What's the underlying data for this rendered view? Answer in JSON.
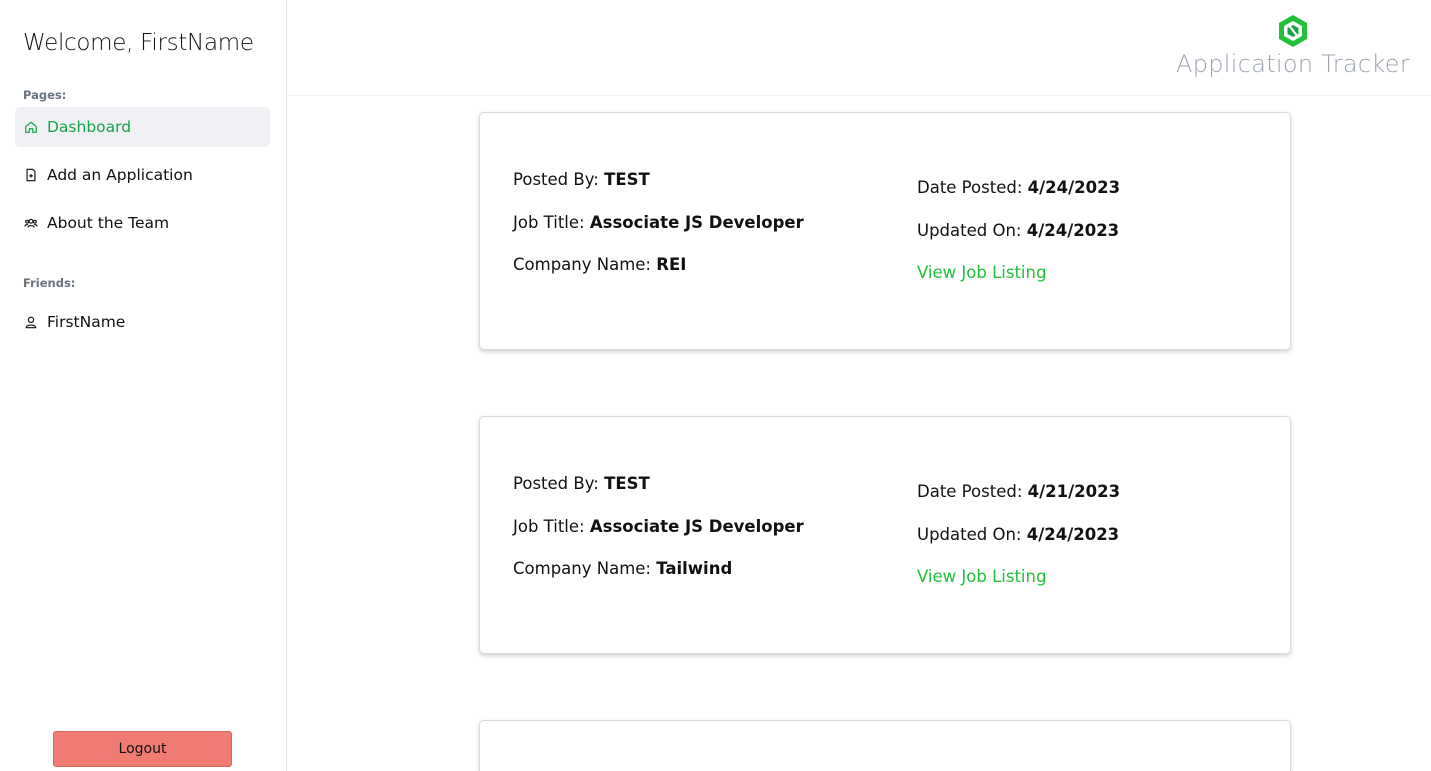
{
  "sidebar": {
    "welcome": "Welcome, FirstName",
    "pages_label": "Pages:",
    "nav": [
      {
        "label": "Dashboard",
        "icon": "home-icon",
        "active": true
      },
      {
        "label": "Add an Application",
        "icon": "file-plus-icon",
        "active": false
      },
      {
        "label": "About the Team",
        "icon": "users-icon",
        "active": false
      }
    ],
    "friends_label": "Friends:",
    "friends": [
      {
        "label": "FirstName",
        "icon": "user-icon"
      }
    ],
    "logout_label": "Logout"
  },
  "header": {
    "logo_text": "Application Tracker",
    "logo_icon": "hexagon-logo-icon"
  },
  "labels": {
    "posted_by": "Posted By:",
    "job_title": "Job Title:",
    "company_name": "Company Name:",
    "date_posted": "Date Posted:",
    "updated_on": "Updated On:",
    "view_listing": "View Job Listing"
  },
  "jobs": [
    {
      "posted_by": "TEST",
      "job_title": "Associate JS Developer",
      "company": "REI",
      "date_posted": "4/24/2023",
      "updated_on": "4/24/2023"
    },
    {
      "posted_by": "TEST",
      "job_title": "Associate JS Developer",
      "company": "Tailwind",
      "date_posted": "4/21/2023",
      "updated_on": "4/24/2023"
    }
  ],
  "colors": {
    "accent": "#16a34a",
    "link": "#22c03a",
    "logout": "#f07b72"
  }
}
